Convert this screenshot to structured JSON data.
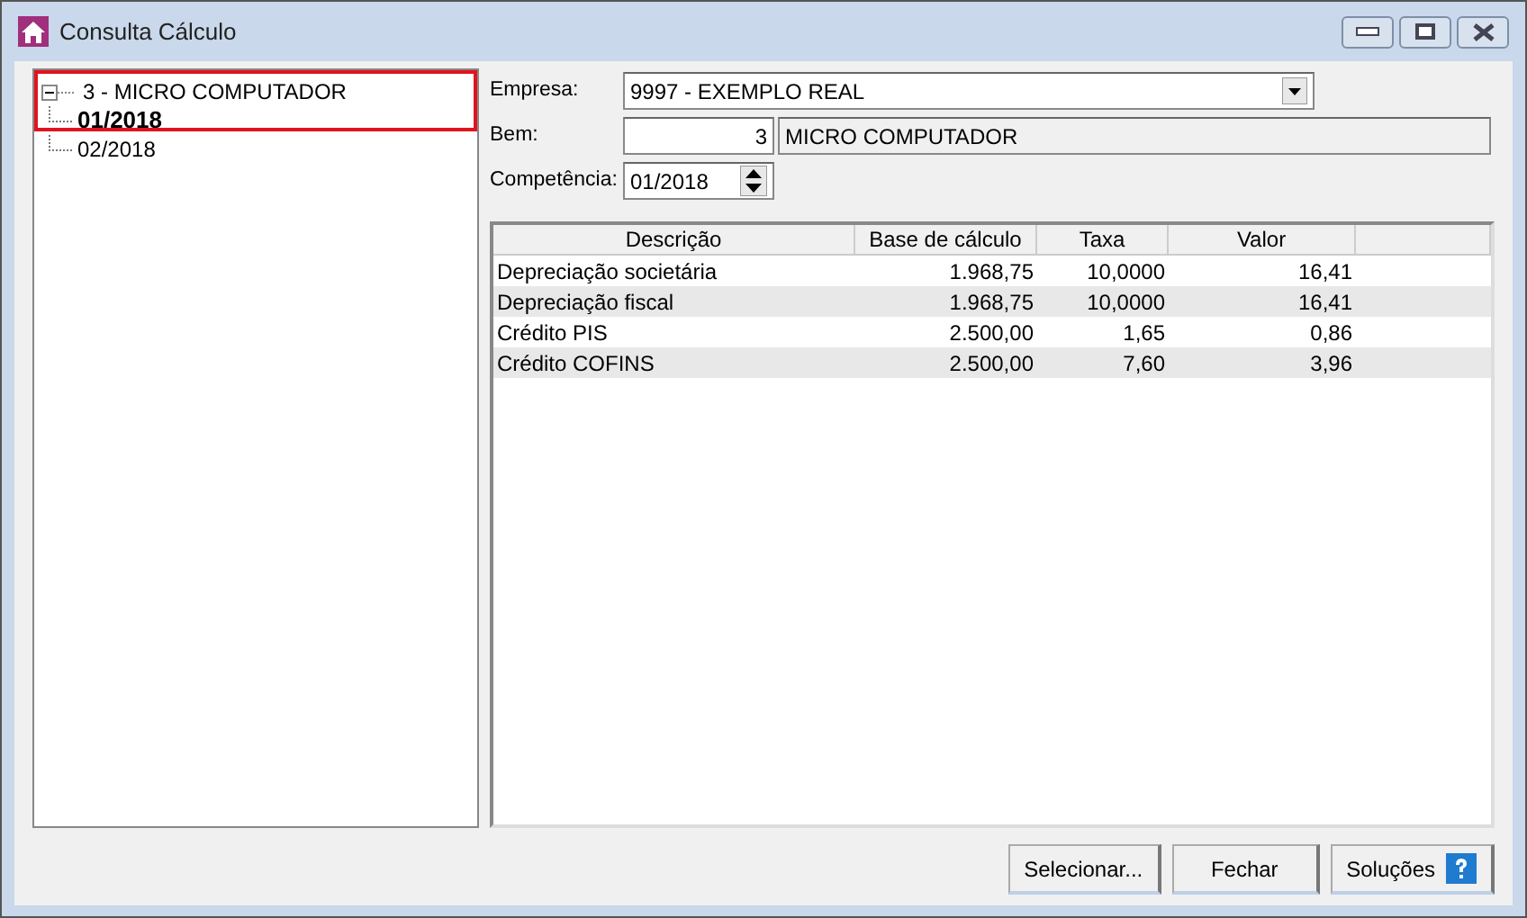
{
  "window": {
    "title": "Consulta Cálculo"
  },
  "tree": [
    {
      "label": "3 - MICRO COMPUTADOR",
      "expanded": true,
      "selected": false,
      "children": [
        {
          "label": "01/2018",
          "selected": true
        },
        {
          "label": "02/2018",
          "selected": false
        }
      ]
    }
  ],
  "form": {
    "empresa": {
      "label": "Empresa:",
      "value": "9997 - EXEMPLO REAL"
    },
    "bem": {
      "label": "Bem:",
      "code": "3",
      "description": "MICRO COMPUTADOR"
    },
    "competencia": {
      "label": "Competência:",
      "value": "01/2018"
    }
  },
  "table": {
    "columns": [
      "Descrição",
      "Base de cálculo",
      "Taxa",
      "Valor"
    ],
    "rows": [
      [
        "Depreciação societária",
        "1.968,75",
        "10,0000",
        "16,41"
      ],
      [
        "Depreciação fiscal",
        "1.968,75",
        "10,0000",
        "16,41"
      ],
      [
        "Crédito PIS",
        "2.500,00",
        "1,65",
        "0,86"
      ],
      [
        "Crédito COFINS",
        "2.500,00",
        "7,60",
        "3,96"
      ]
    ]
  },
  "buttons": [
    {
      "label": "Selecionar...",
      "kind": "plain"
    },
    {
      "label": "Fechar",
      "kind": "plain"
    },
    {
      "label": "Soluções",
      "kind": "help"
    }
  ]
}
